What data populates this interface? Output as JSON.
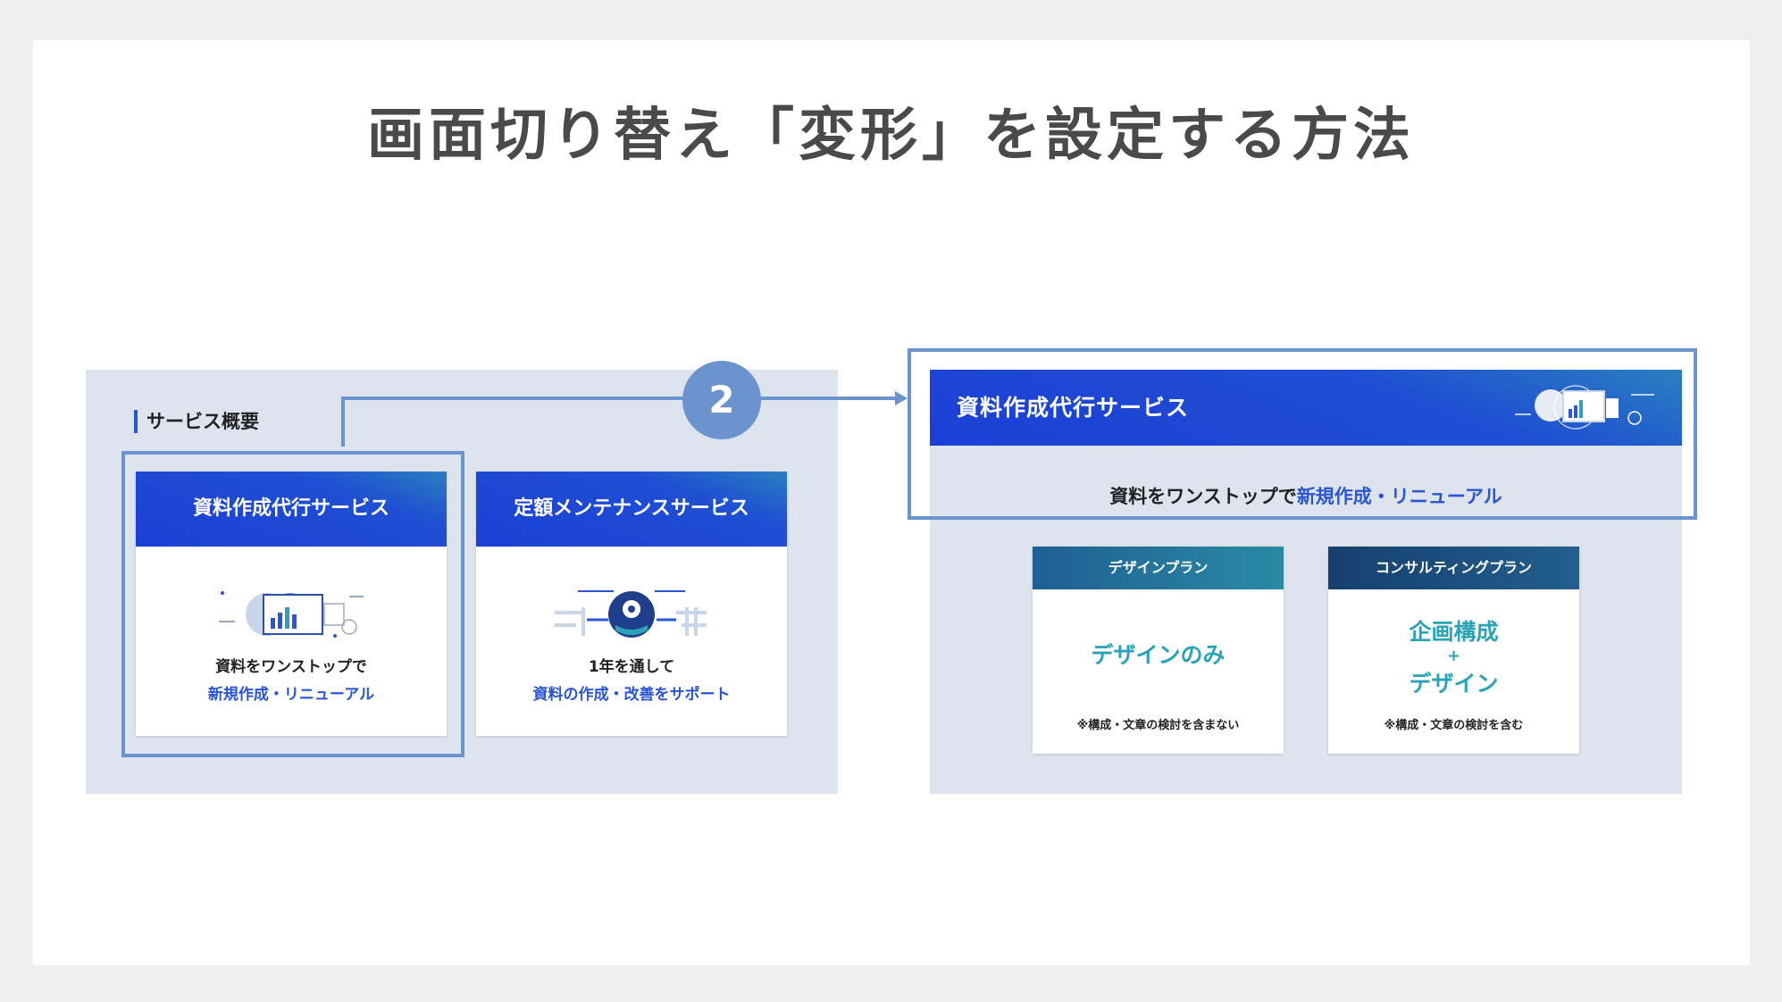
{
  "title": "画面切り替え「変形」を設定する方法",
  "step_number": "2",
  "overview": {
    "heading": "サービス概要",
    "cards": [
      {
        "title": "資料作成代行サービス",
        "line1": "資料をワンストップで",
        "line2": "新規作成・リニューアル",
        "icon": "chart-presentation-icon"
      },
      {
        "title": "定額メンテナンスサービス",
        "line1": "1年を通して",
        "line2": "資料の作成・改善をサポート",
        "icon": "gear-hand-icon"
      }
    ]
  },
  "detail": {
    "title": "資料作成代行サービス",
    "subtitle_prefix": "資料をワンストップで",
    "subtitle_accent": "新規作成・リニューアル",
    "icon": "chart-presentation-icon",
    "plans": [
      {
        "head": "デザインプラン",
        "main": "デザインのみ",
        "note": "※構成・文章の検討を含まない"
      },
      {
        "head": "コンサルティングプラン",
        "main_line1": "企画構成",
        "plus": "+",
        "main_line2": "デザイン",
        "note": "※構成・文章の検討を含む"
      }
    ]
  },
  "colors": {
    "brand_blue": "#1f4fd2",
    "accent_text": "#2a55d4",
    "panel_bg": "#dee4ee",
    "highlight": "#6b94cf",
    "teal": "#2aa3b8"
  }
}
